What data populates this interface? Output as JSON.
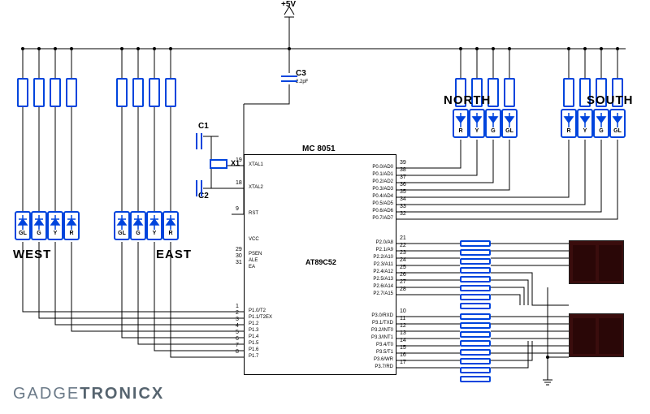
{
  "power": "+5V",
  "capacitors": {
    "c1": "C1",
    "c2": "C2",
    "c3": "C3",
    "c3_val": "2.2pF"
  },
  "crystal": "X1",
  "mcu": {
    "family": "MC 8051",
    "part": "AT89C52"
  },
  "directions": {
    "west": "WEST",
    "east": "EAST",
    "north": "NORTH",
    "south": "SOUTH"
  },
  "led_letters_down": [
    "R",
    "Y",
    "G",
    "GL"
  ],
  "led_letters_up": [
    "GL",
    "G",
    "Y",
    "R"
  ],
  "pins_left": [
    {
      "n": "19",
      "name": "XTAL1"
    },
    {
      "n": "18",
      "name": "XTAL2"
    },
    {
      "n": "9",
      "name": "RST"
    },
    {
      "n": "",
      "name": "VCC"
    },
    {
      "n": "29",
      "name": "PSEN"
    },
    {
      "n": "30",
      "name": "ALE"
    },
    {
      "n": "31",
      "name": "EA"
    },
    {
      "n": "1",
      "name": "P1.0/T2"
    },
    {
      "n": "2",
      "name": "P1.1/T2EX"
    },
    {
      "n": "3",
      "name": "P1.2"
    },
    {
      "n": "4",
      "name": "P1.3"
    },
    {
      "n": "5",
      "name": "P1.4"
    },
    {
      "n": "6",
      "name": "P1.5"
    },
    {
      "n": "7",
      "name": "P1.6"
    },
    {
      "n": "8",
      "name": "P1.7"
    }
  ],
  "pins_right": [
    {
      "n": "39",
      "name": "P0.0/AD0"
    },
    {
      "n": "38",
      "name": "P0.1/AD1"
    },
    {
      "n": "37",
      "name": "P0.2/AD2"
    },
    {
      "n": "36",
      "name": "P0.3/AD3"
    },
    {
      "n": "35",
      "name": "P0.4/AD4"
    },
    {
      "n": "34",
      "name": "P0.5/AD5"
    },
    {
      "n": "33",
      "name": "P0.6/AD6"
    },
    {
      "n": "32",
      "name": "P0.7/AD7"
    },
    {
      "n": "21",
      "name": "P2.0/A8"
    },
    {
      "n": "22",
      "name": "P2.1/A9"
    },
    {
      "n": "23",
      "name": "P2.2/A10"
    },
    {
      "n": "24",
      "name": "P2.3/A11"
    },
    {
      "n": "25",
      "name": "P2.4/A12"
    },
    {
      "n": "26",
      "name": "P2.5/A13"
    },
    {
      "n": "27",
      "name": "P2.6/A14"
    },
    {
      "n": "28",
      "name": "P2.7/A15"
    },
    {
      "n": "10",
      "name": "P3.0/RXD"
    },
    {
      "n": "11",
      "name": "P3.1/TXD"
    },
    {
      "n": "12",
      "name": "P3.2/INT0"
    },
    {
      "n": "13",
      "name": "P3.3/INT1"
    },
    {
      "n": "14",
      "name": "P3.4/T0"
    },
    {
      "n": "15",
      "name": "P3.5/T1"
    },
    {
      "n": "16",
      "name": "P3.6/WR"
    },
    {
      "n": "17",
      "name": "P3.7/RD"
    }
  ],
  "logo": {
    "a": "GADGE",
    "b": "TRONICX"
  }
}
